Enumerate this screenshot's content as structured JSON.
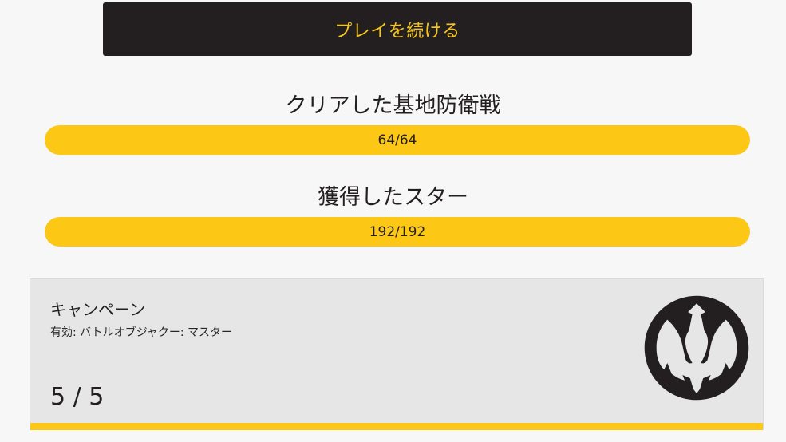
{
  "continue_button": {
    "label": "プレイを続ける"
  },
  "bases_cleared": {
    "title": "クリアした基地防衛戦",
    "progress_text": "64/64",
    "progress_fraction": 1.0
  },
  "stars_earned": {
    "title": "獲得したスター",
    "progress_text": "192/192",
    "progress_fraction": 1.0
  },
  "campaign": {
    "title": "キャンペーン",
    "subtitle": "有効: バトルオブジャクー: マスター",
    "count": "5 / 5",
    "progress_fraction": 1.0,
    "emblem": "rebel-alliance-icon"
  },
  "colors": {
    "accent": "#fcc815",
    "dark": "#231f20",
    "background": "#f7f7f7",
    "card": "#e6e6e6"
  }
}
